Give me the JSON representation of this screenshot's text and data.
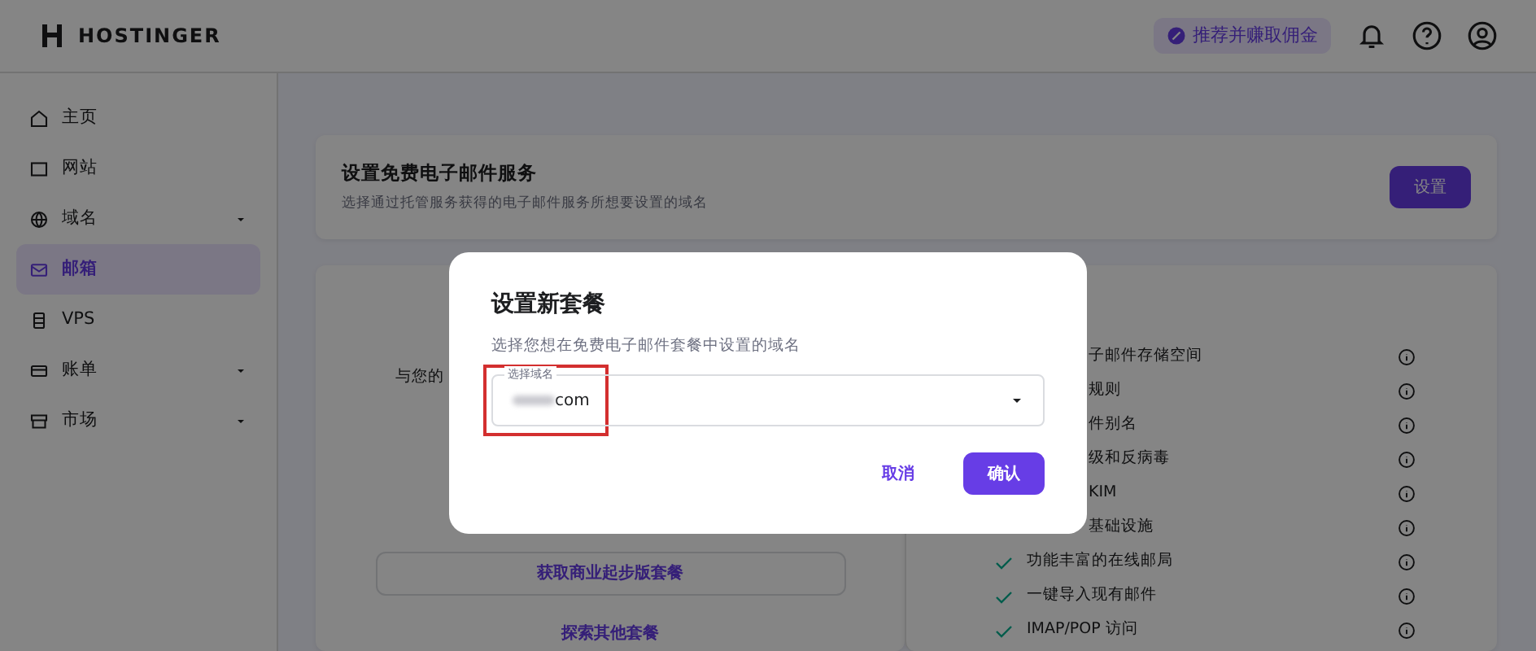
{
  "header": {
    "logo": "HOSTINGER",
    "referral": "推荐并赚取佣金"
  },
  "sidebar": {
    "items": [
      {
        "label": "主页",
        "selected": false,
        "expandable": false
      },
      {
        "label": "网站",
        "selected": false,
        "expandable": false
      },
      {
        "label": "域名",
        "selected": false,
        "expandable": true
      },
      {
        "label": "邮箱",
        "selected": true,
        "expandable": false
      },
      {
        "label": "VPS",
        "selected": false,
        "expandable": false
      },
      {
        "label": "账单",
        "selected": false,
        "expandable": true
      },
      {
        "label": "市场",
        "selected": false,
        "expandable": true
      }
    ]
  },
  "setup_card": {
    "title": "设置免费电子邮件服务",
    "subtitle": "选择通过托管服务获得的电子邮件服务所想要设置的域名",
    "button": "设置"
  },
  "plan_card": {
    "text": "与您的",
    "primary_button": "获取商业起步版套餐",
    "link": "探索其他套餐"
  },
  "features": [
    {
      "text": "子邮件存储空间",
      "check": false
    },
    {
      "text": "规则",
      "check": false
    },
    {
      "text": "件别名",
      "check": false
    },
    {
      "text": "级和反病毒",
      "check": false
    },
    {
      "text": "KIM",
      "check": false
    },
    {
      "text": "基础设施",
      "check": false
    },
    {
      "text": "功能丰富的在线邮局",
      "check": true
    },
    {
      "text": "一键导入现有邮件",
      "check": true
    },
    {
      "text": "IMAP/POP 访问",
      "check": true
    }
  ],
  "modal": {
    "title": "设置新套餐",
    "subtitle": "选择您想在免费电子邮件套餐中设置的域名",
    "field_label": "选择域名",
    "field_value": "com",
    "cancel": "取消",
    "confirm": "确认"
  }
}
